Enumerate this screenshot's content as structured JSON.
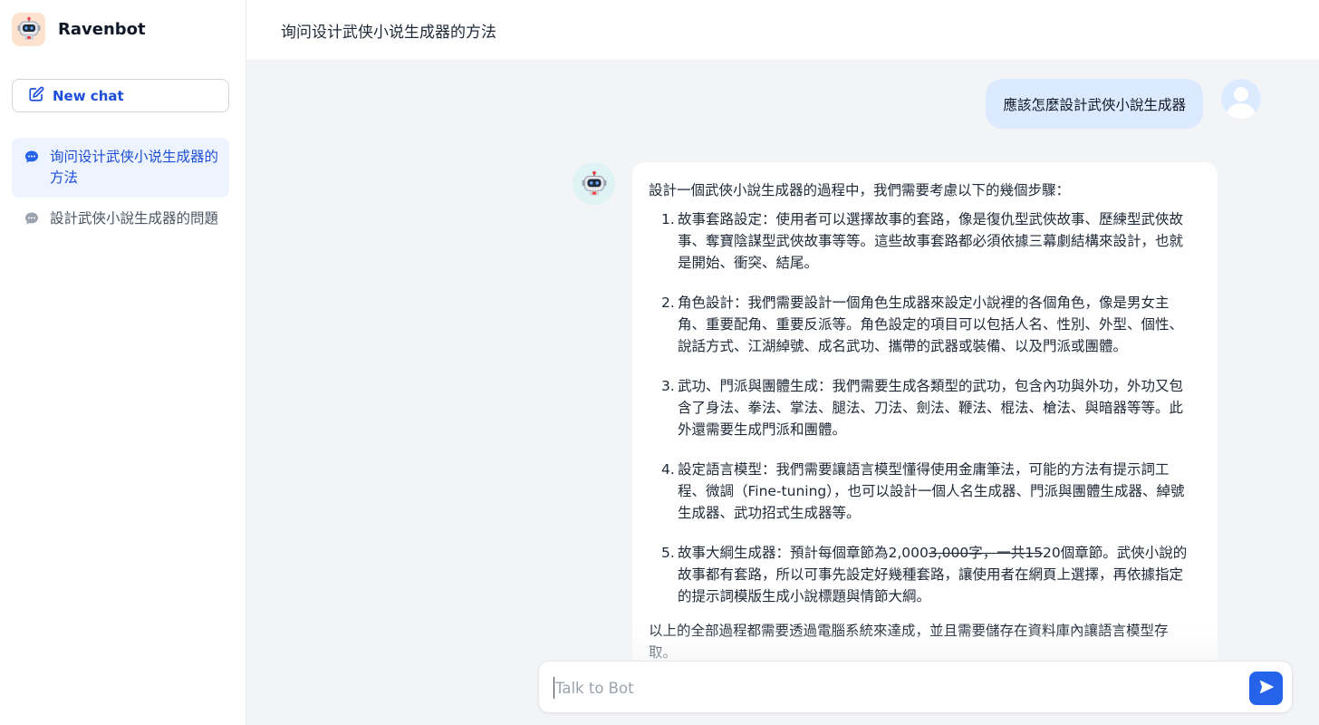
{
  "app": {
    "name": "Ravenbot",
    "new_chat_label": "New chat"
  },
  "sidebar": {
    "chats": [
      {
        "label": "询问设计武侠小说生成器的方法",
        "active": true
      },
      {
        "label": "設計武俠小說生成器的問題",
        "active": false
      }
    ]
  },
  "header": {
    "title": "询问设计武侠小说生成器的方法"
  },
  "conversation": {
    "user_message": "應該怎麼設計武俠小說生成器",
    "bot_intro": "設計一個武俠小說生成器的過程中，我們需要考慮以下的幾個步驟：",
    "bot_steps": [
      {
        "num": "1.",
        "text": "故事套路設定：使用者可以選擇故事的套路，像是復仇型武俠故事、歷練型武俠故事、奪寶陰謀型武俠故事等等。這些故事套路都必須依據三幕劇結構來設計，也就是開始、衝突、結尾。"
      },
      {
        "num": "2.",
        "text": "角色設計：我們需要設計一個角色生成器來設定小說裡的各個角色，像是男女主角、重要配角、重要反派等。角色設定的項目可以包括人名、性別、外型、個性、說話方式、江湖綽號、成名武功、攜帶的武器或裝備、以及門派或團體。"
      },
      {
        "num": "3.",
        "text": "武功、門派與團體生成：我們需要生成各類型的武功，包含內功與外功，外功又包含了身法、拳法、掌法、腿法、刀法、劍法、鞭法、棍法、槍法、與暗器等等。此外還需要生成門派和團體。"
      },
      {
        "num": "4.",
        "text": "設定語言模型：我們需要讓語言模型懂得使用金庸筆法，可能的方法有提示詞工程、微調（Fine-tuning），也可以設計一個人名生成器、門派與團體生成器、綽號生成器、武功招式生成器等。"
      },
      {
        "num": "5.",
        "text_before": "故事大綱生成器：預計每個章節為2,000",
        "text_strike": "3,000字，一共15",
        "text_after": "20個章節。武俠小說的故事都有套路，所以可事先設定好幾種套路，讓使用者在網頁上選擇，再依據指定的提示詞模版生成小說標題與情節大綱。"
      }
    ],
    "bot_outro": "以上的全部過程都需要透過電腦系統來達成，並且需要儲存在資料庫內讓語言模型存取。"
  },
  "composer": {
    "placeholder": "Talk to Bot"
  },
  "colors": {
    "accent": "#2563eb",
    "user_bubble": "#dbeafe",
    "active_item_bg": "#eef4ff",
    "main_bg": "#f3f4f6"
  },
  "icons": {
    "brand": "robot-icon",
    "new_chat": "edit-icon",
    "chat_item": "chat-bubble-icon",
    "user_avatar": "user-avatar-icon",
    "bot_avatar": "robot-icon",
    "send": "send-icon"
  }
}
